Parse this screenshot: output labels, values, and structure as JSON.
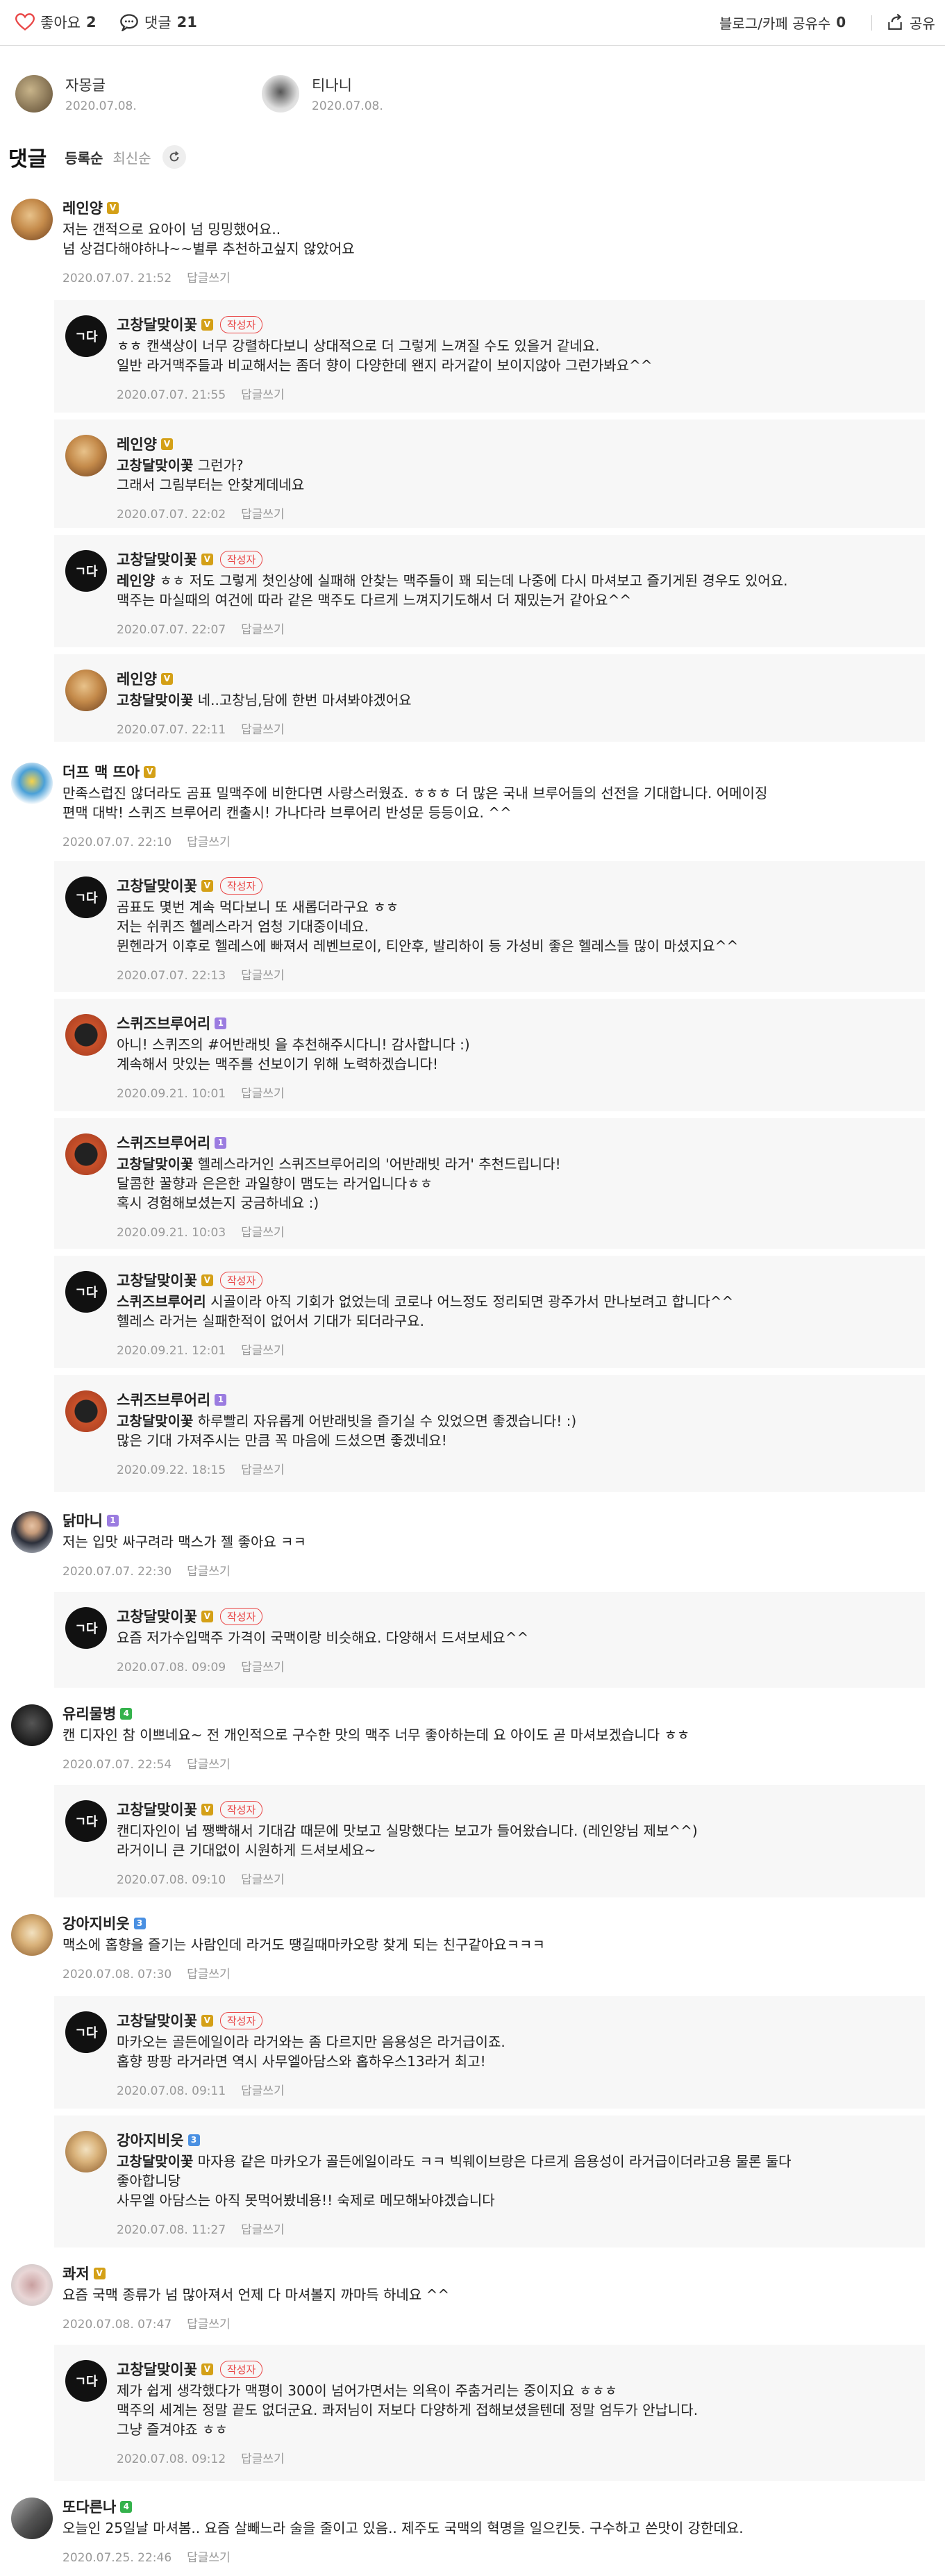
{
  "topbar": {
    "like_label": "좋아요",
    "like_count": "2",
    "comment_label": "댓글",
    "comment_count": "21",
    "share_count_label": "블로그/카페 공유수",
    "share_count": "0",
    "share_label": "공유"
  },
  "related": [
    {
      "title": "자몽글",
      "date": "2020.07.08."
    },
    {
      "title": "티나니",
      "date": "2020.07.08."
    }
  ],
  "comments_header": {
    "title": "댓글",
    "sort_registered": "등록순",
    "sort_latest": "최신순"
  },
  "reply_label": "답글쓰기",
  "writer_tag": "작성자",
  "comments": [
    {
      "name": "레인양",
      "badge": "V",
      "lines": [
        "저는 갠적으로 요아이 넘 밍밍했어요..",
        "넘 상검다해야하나~~별루 추천하고싶지 않았어요"
      ],
      "date": "2020.07.07. 21:52"
    },
    {
      "name": "고창달맞이꽃",
      "badge": "V",
      "writer": true,
      "lines": [
        "ㅎㅎ 캔색상이 너무 강렬하다보니 상대적으로 더 그렇게 느껴질 수도 있을거 같네요.",
        "일반 라거맥주들과 비교해서는 좀더 향이 다양한데 왠지 라거같이 보이지않아 그런가봐요^^"
      ],
      "date": "2020.07.07. 21:55"
    },
    {
      "name": "레인양",
      "badge": "V",
      "lines": [
        "고창달맞이꽃 그런가?",
        "그래서 그림부터는 안찾게데네요"
      ],
      "mention": "고창달맞이꽃",
      "date": "2020.07.07. 22:02"
    },
    {
      "name": "고창달맞이꽃",
      "badge": "V",
      "writer": true,
      "lines": [
        "레인양 ㅎㅎ 저도 그렇게 첫인상에 실패해 안찾는 맥주들이 꽤 되는데 나중에 다시 마셔보고 즐기게된 경우도 있어요.",
        "맥주는 마실때의 여건에 따라 같은 맥주도 다르게 느껴지기도해서 더 재밌는거 같아요^^"
      ],
      "mention": "레인양",
      "date": "2020.07.07. 22:07"
    },
    {
      "name": "레인양",
      "badge": "V",
      "lines": [
        "고창달맞이꽃 네..고창님,담에 한번 마셔봐야겠어요"
      ],
      "mention": "고창달맞이꽃",
      "date": "2020.07.07. 22:11"
    },
    {
      "name": "더프 맥 뜨아",
      "badge": "V",
      "lines": [
        "만족스럽진 않더라도 곰표 밀맥주에 비한다면 사랑스러웠죠. ㅎㅎㅎ 더 많은 국내 브루어들의 선전을 기대합니다. 어메이징",
        "편맥 대박! 스퀴즈 브루어리 캔출시! 가나다라 브루어리 반성문 등등이요. ^^"
      ],
      "date": "2020.07.07. 22:10"
    },
    {
      "name": "고창달맞이꽃",
      "badge": "V",
      "writer": true,
      "lines": [
        "곰표도 몇번 계속 먹다보니 또 새롭더라구요 ㅎㅎ",
        "저는 쉬퀴즈 헬레스라거 엄청 기대중이네요.",
        "뮌헨라거 이후로 헬레스에 빠져서 레벤브로이, 티안후, 발리하이 등 가성비 좋은 헬레스들 많이 마셨지요^^"
      ],
      "date": "2020.07.07. 22:13"
    },
    {
      "name": "스퀴즈브루어리",
      "badge": "1",
      "lines": [
        "아니! 스퀴즈의 #어반래빗 을 추천해주시다니! 감사합니다 :)",
        "계속해서 맛있는 맥주를 선보이기 위해 노력하겠습니다!"
      ],
      "date": "2020.09.21. 10:01"
    },
    {
      "name": "스퀴즈브루어리",
      "badge": "1",
      "lines": [
        "고창달맞이꽃 헬레스라거인 스퀴즈브루어리의 '어반래빗 라거' 추천드립니다!",
        "달콤한 꿀향과 은은한 과일향이 맴도는 라거입니다ㅎㅎ",
        "혹시 경험해보셨는지 궁금하네요 :)"
      ],
      "mention": "고창달맞이꽃",
      "date": "2020.09.21. 10:03"
    },
    {
      "name": "고창달맞이꽃",
      "badge": "V",
      "writer": true,
      "lines": [
        "스퀴즈브루어리 시골이라 아직 기회가 없었는데 코로나 어느정도 정리되면 광주가서 만나보려고 합니다^^",
        "헬레스 라거는 실패한적이 없어서 기대가 되더라구요."
      ],
      "mention": "스퀴즈브루어리",
      "date": "2020.09.21. 12:01"
    },
    {
      "name": "스퀴즈브루어리",
      "badge": "1",
      "lines": [
        "고창달맞이꽃 하루빨리 자유롭게 어반래빗을 즐기실 수 있었으면 좋겠습니다! :)",
        "많은 기대 가져주시는 만큼 꼭 마음에 드셨으면 좋겠네요!"
      ],
      "mention": "고창달맞이꽃",
      "date": "2020.09.22. 18:15"
    },
    {
      "name": "닭마니",
      "badge": "1",
      "lines": [
        "저는 입맛 싸구려라 맥스가 젤 좋아요 ㅋㅋ"
      ],
      "date": "2020.07.07. 22:30"
    },
    {
      "name": "고창달맞이꽃",
      "badge": "V",
      "writer": true,
      "lines": [
        "요즘 저가수입맥주 가격이 국맥이랑 비슷해요. 다양해서 드셔보세요^^"
      ],
      "date": "2020.07.08. 09:09"
    },
    {
      "name": "유리물병",
      "badge": "4",
      "lines": [
        "캔 디자인 참 이쁘네요~ 전 개인적으로 구수한 맛의 맥주 너무 좋아하는데 요 아이도 곧 마셔보겠습니다 ㅎㅎ"
      ],
      "date": "2020.07.07. 22:54"
    },
    {
      "name": "고창달맞이꽃",
      "badge": "V",
      "writer": true,
      "lines": [
        "캔디자인이 넘 쨍빡해서 기대감 때문에 맛보고 실망했다는 보고가 들어왔습니다. (레인양님 제보^^)",
        "라거이니 큰 기대없이 시원하게 드셔보세요~"
      ],
      "date": "2020.07.08. 09:10"
    },
    {
      "name": "강아지비읏",
      "badge": "3",
      "lines": [
        "맥소에 홉향을 즐기는 사람인데 라거도 땡길때마카오랑 찾게 되는 친구같아요ㅋㅋㅋ"
      ],
      "date": "2020.07.08. 07:30"
    },
    {
      "name": "고창달맞이꽃",
      "badge": "V",
      "writer": true,
      "lines": [
        "마카오는 골든에일이라 라거와는 좀 다르지만 음용성은 라거급이죠.",
        "홉향 팡팡 라거라면 역시 사무엘아담스와 홉하우스13라거 최고!"
      ],
      "date": "2020.07.08. 09:11"
    },
    {
      "name": "강아지비읏",
      "badge": "3",
      "lines": [
        "고창달맞이꽃 마자용 같은 마카오가 골든에일이라도 ㅋㅋ 빅웨이브랑은 다르게 음용성이 라거급이더라고용 물론 둘다",
        "좋아합니당",
        "사무엘 아담스는 아직 못먹어봤네용!! 숙제로 메모해놔야겠습니다"
      ],
      "mention": "고창달맞이꽃",
      "date": "2020.07.08. 11:27"
    },
    {
      "name": "콰저",
      "badge": "V",
      "lines": [
        "요즘 국맥 종류가 넘 많아져서 언제 다 마셔볼지 까마득 하네요 ^^"
      ],
      "date": "2020.07.08. 07:47"
    },
    {
      "name": "고창달맞이꽃",
      "badge": "V",
      "writer": true,
      "lines": [
        "제가 쉽게 생각했다가 맥평이 300이 넘어가면서는 의욕이 주춤거리는 중이지요 ㅎㅎㅎ",
        "맥주의 세계는 정말 끝도 없더군요. 콰저님이 저보다 다양하게 접해보셨을텐데 정말 엄두가 안납니다.",
        "그냥 즐겨야죠 ㅎㅎ"
      ],
      "date": "2020.07.08. 09:12"
    },
    {
      "name": "또다른나",
      "badge": "4",
      "lines": [
        "오늘인 25일날 마셔봄.. 요즘 살빼느라 술을 줄이고 있음.. 제주도 국맥의 혁명을 일으킨듯. 구수하고 쓴맛이 강한데요."
      ],
      "date": "2020.07.25. 22:46"
    }
  ],
  "colors": {
    "heart": "#e94646",
    "gold_badge": "#d4a017",
    "purple_badge": "#9b7ce0",
    "green_badge": "#34b24c",
    "blue_badge": "#4a90e2",
    "writer_tag": "#e94646"
  }
}
